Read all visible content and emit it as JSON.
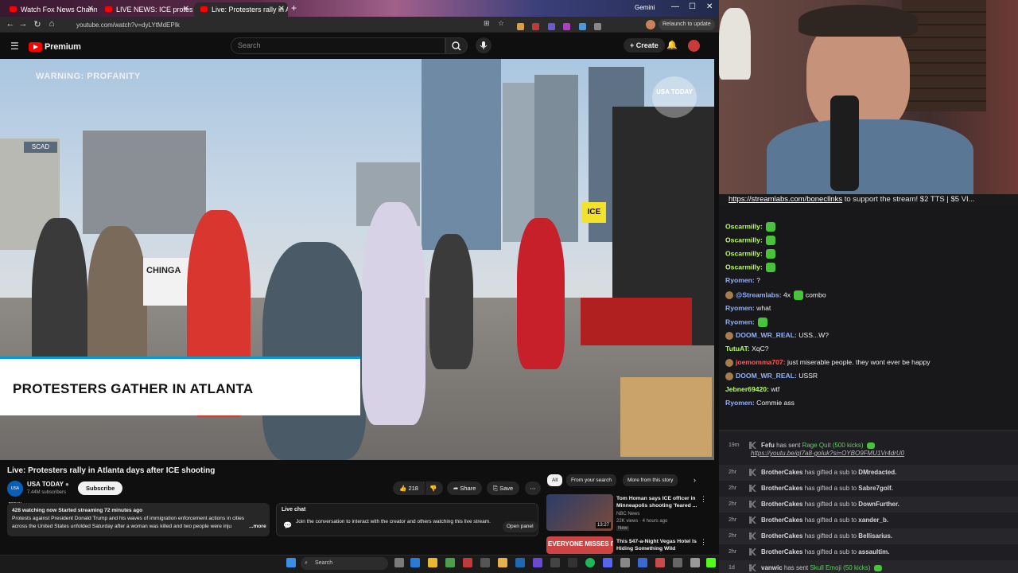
{
  "browser": {
    "tabs": [
      {
        "title": "Watch Fox News Channel O",
        "active": false
      },
      {
        "title": "LIVE NEWS: ICE protests contin",
        "active": false
      },
      {
        "title": "Live: Protesters rally in Atla",
        "active": true
      }
    ],
    "gemini_label": "Gemini",
    "url": "youtube.com/watch?v=dyLYtMdEPIk",
    "relaunch_label": "Relaunch to update"
  },
  "youtube": {
    "logo_text": "Premium",
    "search_placeholder": "Search",
    "create_label": "Create",
    "video": {
      "warning_text": "WARNING: PROFANITY",
      "lower_third": "PROTESTERS GATHER IN ATLANTA",
      "watermark": "USA TODAY",
      "sign_chinga": "CHINGA",
      "sign_ice": "ICE",
      "sign_scad": "SCAD"
    },
    "title": "Live: Protesters rally in Atlanta days after ICE shooting",
    "channel": {
      "name": "USA TODAY",
      "subs": "7.44M subscribers",
      "avatar_text": "USA TODAY"
    },
    "subscribe_label": "Subscribe",
    "likes": "218",
    "share_label": "Share",
    "save_label": "Save",
    "description": {
      "stats": "428 watching now  Started streaming 72 minutes ago",
      "text": "Protests against President Donald Trump and his waves of immigration enforcement actions in cities across the United States unfolded Saturday after a woman was killed and two people were inju",
      "more": "...more"
    },
    "live_chat": {
      "title": "Live chat",
      "text": "Join the conversation to interact with the creator and others watching this live stream.",
      "button": "Open panel"
    },
    "chips": [
      "All",
      "From your search",
      "More from this story"
    ],
    "recommendations": [
      {
        "title": "Tom Homan says ICE officer in Minneapolis shooting 'feared ...",
        "channel": "NBC News",
        "meta": "22K views · 4 hours ago",
        "badge": "New",
        "duration": "13:27"
      },
      {
        "title": "This $47-a-Night Vegas Hotel Is Hiding Something Wild",
        "thumb_text": "EVERYONE MISSES IT"
      }
    ]
  },
  "taskbar": {
    "search_label": "Search"
  },
  "stream": {
    "link_text": "https://streamlabs.com/bonecllnks",
    "link_suffix": " to support the stream! $2 TTS | $5 VI..."
  },
  "chat": [
    {
      "user": "Oscarmilly:",
      "color": "#b6ff5c",
      "text": "",
      "emote": true
    },
    {
      "user": "Oscarmilly:",
      "color": "#b6ff5c",
      "text": "",
      "emote": true
    },
    {
      "user": "Oscarmilly:",
      "color": "#b6ff5c",
      "text": "",
      "emote": true
    },
    {
      "user": "Oscarmilly:",
      "color": "#b6ff5c",
      "text": "",
      "emote": true
    },
    {
      "user": "Ryomen:",
      "color": "#8fb3ff",
      "text": " ?",
      "emote": false
    },
    {
      "user": "@Streamlabs:",
      "color": "#8fb3ff",
      "text": " 4x",
      "emote": true,
      "suffix": " combo",
      "badge": true
    },
    {
      "user": "Ryomen:",
      "color": "#8fb3ff",
      "text": " what",
      "emote": false
    },
    {
      "user": "Ryomen:",
      "color": "#8fb3ff",
      "text": "",
      "emote": true
    },
    {
      "user": "DOOM_WR_REAL:",
      "color": "#8fb3ff",
      "text": " USS...W?",
      "emote": false,
      "badge": true
    },
    {
      "user": "TutuAT:",
      "color": "#b6ff5c",
      "text": " XqC?",
      "emote": false
    },
    {
      "user": "joemomma707:",
      "color": "#ff5a5a",
      "text": " just miserable people. they wont ever be happy",
      "emote": false,
      "badge": true
    },
    {
      "user": "DOOM_WR_REAL:",
      "color": "#8fb3ff",
      "text": " USSR",
      "emote": false,
      "badge": true
    },
    {
      "user": "Jebner69420:",
      "color": "#b6ff5c",
      "text": " wtf",
      "emote": false
    },
    {
      "user": "Ryomen:",
      "color": "#8fb3ff",
      "text": " Commie ass",
      "emote": false
    }
  ],
  "events": [
    {
      "time": "19m",
      "name": "Fefu",
      "pre": " has sent ",
      "highlight": "Rage Quit (500 kicks)",
      "post": "",
      "link": "https://youtu.be/qI7a8-goIuk?si=OYBO9FMU1Vr4drU0"
    },
    {
      "time": "2hr",
      "name": "BrotherCakes",
      "pre": " has gifted a sub to ",
      "target": "DMredacted."
    },
    {
      "time": "2hr",
      "name": "BrotherCakes",
      "pre": " has gifted a sub to ",
      "target": "Sabre7golf."
    },
    {
      "time": "2hr",
      "name": "BrotherCakes",
      "pre": " has gifted a sub to ",
      "target": "DownFurther."
    },
    {
      "time": "2hr",
      "name": "BrotherCakes",
      "pre": " has gifted a sub to ",
      "target": "xander_b."
    },
    {
      "time": "2hr",
      "name": "BrotherCakes",
      "pre": " has gifted a sub to ",
      "target": "Bellisarius."
    },
    {
      "time": "2hr",
      "name": "BrotherCakes",
      "pre": " has gifted a sub to ",
      "target": "assaultim."
    },
    {
      "time": "1d",
      "name": "vanwic",
      "pre": " has sent ",
      "highlight": "Skull Emoji (50 kicks)",
      "post": ""
    }
  ],
  "colors": {
    "yt_red": "#ff0000",
    "accent_blue": "#0a9bd6",
    "kick_green": "#48c43a"
  }
}
